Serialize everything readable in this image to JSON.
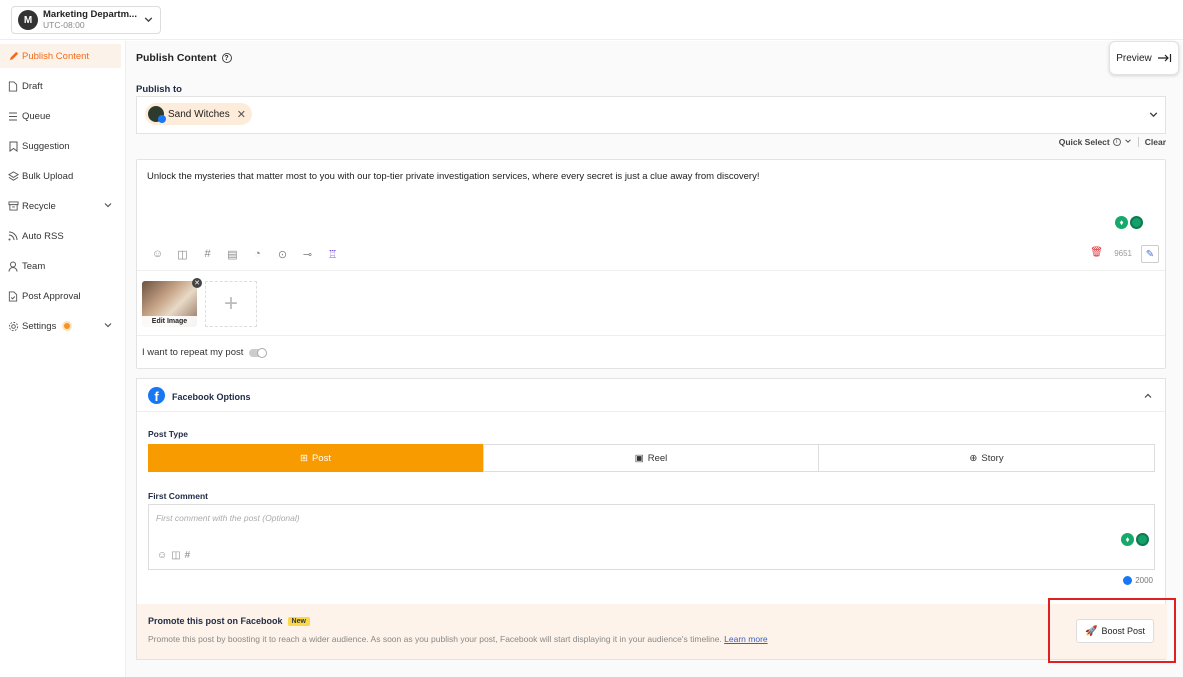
{
  "workspace": {
    "avatar": "M",
    "name": "Marketing Departm...",
    "timezone": "UTC-08:00"
  },
  "sidebar": {
    "items": [
      {
        "label": "Publish Content",
        "icon": "pencil-icon",
        "active": true
      },
      {
        "label": "Draft",
        "icon": "document-icon"
      },
      {
        "label": "Queue",
        "icon": "list-icon"
      },
      {
        "label": "Suggestion",
        "icon": "bookmark-icon"
      },
      {
        "label": "Bulk Upload",
        "icon": "layers-icon"
      },
      {
        "label": "Recycle",
        "icon": "archive-icon",
        "expandable": true
      },
      {
        "label": "Auto RSS",
        "icon": "rss-icon"
      },
      {
        "label": "Team",
        "icon": "user-icon"
      },
      {
        "label": "Post Approval",
        "icon": "approval-icon"
      },
      {
        "label": "Settings",
        "icon": "gear-icon",
        "expandable": true,
        "badge": "dot"
      }
    ]
  },
  "header": {
    "title": "Publish Content",
    "preview": "Preview"
  },
  "publish": {
    "label": "Publish to",
    "account": "Sand Witches",
    "quick_select": "Quick Select",
    "clear": "Clear"
  },
  "editor": {
    "text": "Unlock the mysteries that matter most to you with our top-tier private investigation services, where every secret is just a clue away from discovery!",
    "char_count": "9651"
  },
  "media": {
    "edit_label": "Edit Image"
  },
  "repeat": {
    "label": "I want to repeat my post"
  },
  "facebook": {
    "title": "Facebook Options",
    "post_type_label": "Post Type",
    "types": [
      "Post",
      "Reel",
      "Story"
    ],
    "active_type": "Post",
    "first_comment_label": "First Comment",
    "comment_placeholder": "First comment with the post (Optional)",
    "comment_count": "2000"
  },
  "promote": {
    "title": "Promote this post on Facebook",
    "badge": "New",
    "desc": "Promote this post by boosting it to reach a wider audience. As soon as you publish your post, Facebook will start displaying it in your audience's timeline.",
    "link": "Learn more",
    "button": "Boost Post"
  },
  "colors": {
    "accent": "#f26a1b",
    "active_tab": "#f89b00",
    "facebook": "#1877f2",
    "highlight": "#e02020"
  }
}
